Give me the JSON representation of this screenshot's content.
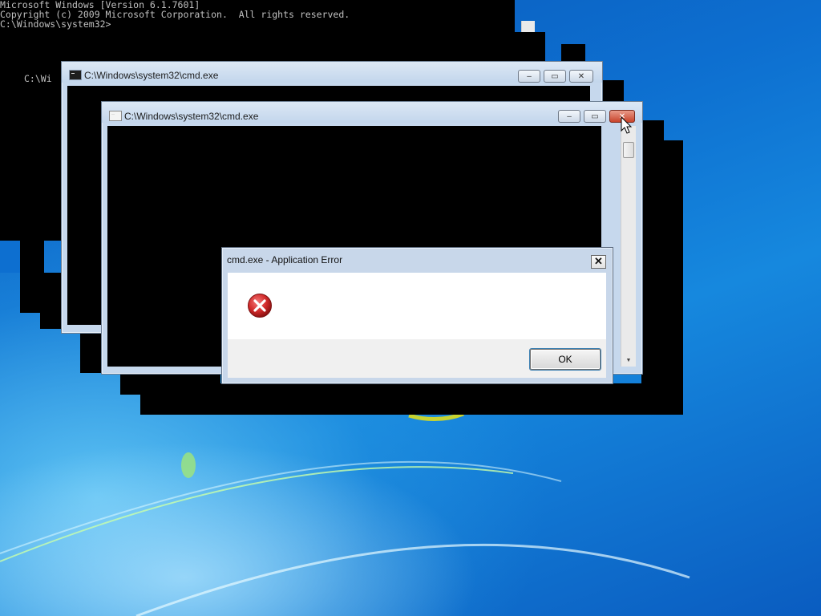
{
  "console": {
    "line1": "Microsoft Windows [Version 6.1.7601]",
    "line2": "Copyright (c) 2009 Microsoft Corporation.  All rights reserved.",
    "line3": "",
    "line4": "C:\\Windows\\system32>",
    "partial_prompt": "C:\\Wi"
  },
  "windows": {
    "cmd_back_title": "C:\\Windows\\system32\\cmd.exe",
    "cmd_front_title": "C:\\Windows\\system32\\cmd.exe"
  },
  "caption_buttons": {
    "minimize_glyph": "–",
    "maximize_glyph": "▭",
    "close_glyph": "✕"
  },
  "dialog": {
    "title": "cmd.exe - Application Error",
    "close_glyph": "✕",
    "icon": "error-icon",
    "ok_label": "OK"
  },
  "colors": {
    "desktop_blue": "#0d6fd0",
    "error_red": "#d22b2b"
  }
}
